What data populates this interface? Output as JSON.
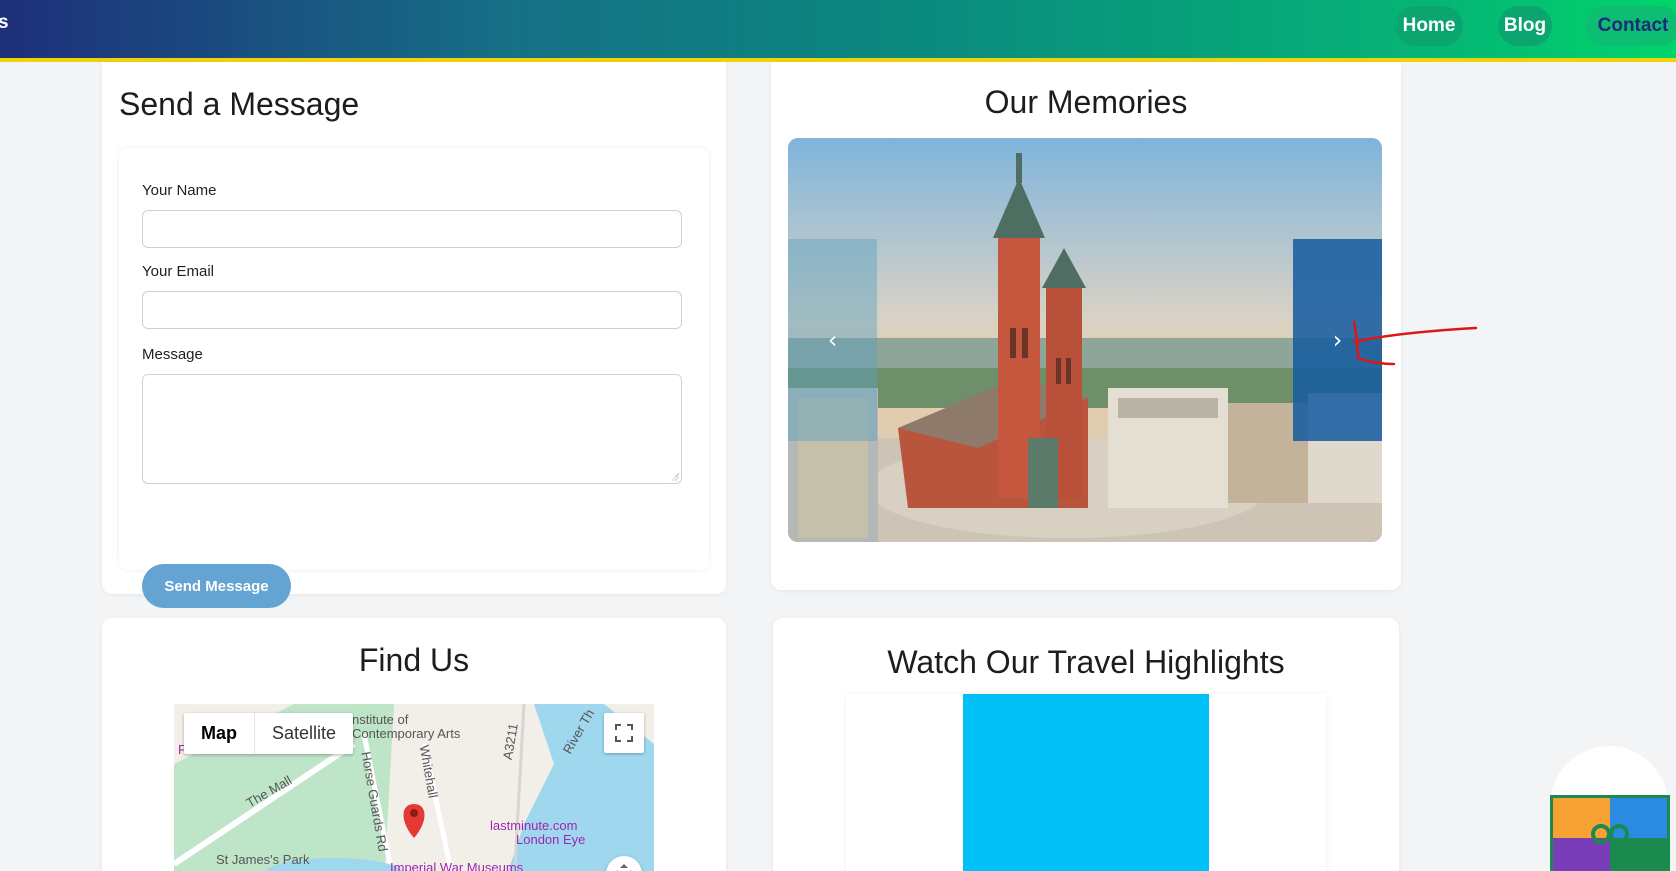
{
  "header": {
    "brand": "s",
    "nav": [
      "Home",
      "Blog",
      "Contact"
    ]
  },
  "send": {
    "title": "Send a Message",
    "name_label": "Your Name",
    "name_value": "",
    "email_label": "Your Email",
    "email_value": "",
    "message_label": "Message",
    "message_value": "",
    "button": "Send Message"
  },
  "memories": {
    "title": "Our Memories",
    "prev": "‹",
    "next": "›"
  },
  "find": {
    "title": "Find Us",
    "map_tab": "Map",
    "satellite_tab": "Satellite",
    "labels": {
      "ica": "nstitute of",
      "ica2": "Contemporary Arts",
      "mall": "The Mall",
      "horse": "Horse Guards Rd",
      "whitehall": "Whitehall",
      "a3211": "A3211",
      "river": "River Th",
      "lastminute": "lastminute.com",
      "london_eye": "London Eye",
      "park": "St James's Park",
      "iwm": "Imperial War Museums",
      "palace": "Palace"
    }
  },
  "watch": {
    "title": "Watch Our Travel Highlights"
  }
}
